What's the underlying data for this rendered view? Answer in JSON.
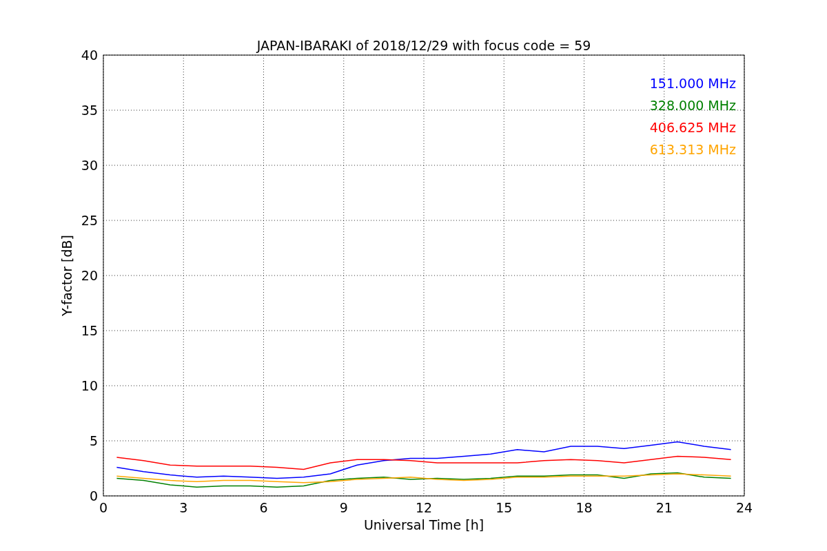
{
  "chart": {
    "chart_data": {
      "type": "line",
      "title": "JAPAN-IBARAKI of 2018/12/29 with focus code = 59",
      "xlabel": "Universal Time [h]",
      "ylabel": "Y-factor [dB]",
      "x": [
        0.5,
        1.5,
        2.5,
        3.5,
        4.5,
        5.5,
        6.5,
        7.5,
        8.5,
        9.5,
        10.5,
        11.5,
        12.5,
        13.5,
        14.5,
        15.5,
        16.5,
        17.5,
        18.5,
        19.5,
        20.5,
        21.5,
        22.5,
        23.5
      ],
      "series": [
        {
          "name": "151.000 MHz",
          "color": "#0000ff",
          "values": [
            2.6,
            2.2,
            1.9,
            1.7,
            1.8,
            1.7,
            1.6,
            1.7,
            2.0,
            2.8,
            3.2,
            3.4,
            3.4,
            3.6,
            3.8,
            4.2,
            4.0,
            4.5,
            4.5,
            4.3,
            4.6,
            4.9,
            4.5,
            4.2
          ]
        },
        {
          "name": "328.000 MHz",
          "color": "#008000",
          "values": [
            1.6,
            1.4,
            1.0,
            0.8,
            0.9,
            0.9,
            0.8,
            0.9,
            1.4,
            1.6,
            1.7,
            1.5,
            1.6,
            1.5,
            1.6,
            1.8,
            1.8,
            1.9,
            1.9,
            1.6,
            2.0,
            2.1,
            1.7,
            1.6
          ]
        },
        {
          "name": "406.625 MHz",
          "color": "#ff0000",
          "values": [
            3.5,
            3.2,
            2.8,
            2.7,
            2.7,
            2.7,
            2.6,
            2.4,
            3.0,
            3.3,
            3.3,
            3.2,
            3.0,
            3.0,
            3.0,
            3.0,
            3.2,
            3.3,
            3.2,
            3.0,
            3.3,
            3.6,
            3.5,
            3.3
          ]
        },
        {
          "name": "613.313 MHz",
          "color": "#ffa500",
          "values": [
            1.8,
            1.6,
            1.4,
            1.3,
            1.4,
            1.4,
            1.3,
            1.2,
            1.3,
            1.5,
            1.6,
            1.7,
            1.5,
            1.4,
            1.5,
            1.7,
            1.7,
            1.8,
            1.8,
            1.8,
            1.9,
            2.0,
            1.9,
            1.8
          ]
        }
      ],
      "grid": true,
      "xlim": [
        0,
        24
      ],
      "ylim": [
        0,
        40
      ],
      "xticks": [
        0,
        3,
        6,
        9,
        12,
        15,
        18,
        21,
        24
      ],
      "yticks": [
        0,
        5,
        10,
        15,
        20,
        25,
        30,
        35,
        40
      ]
    }
  }
}
